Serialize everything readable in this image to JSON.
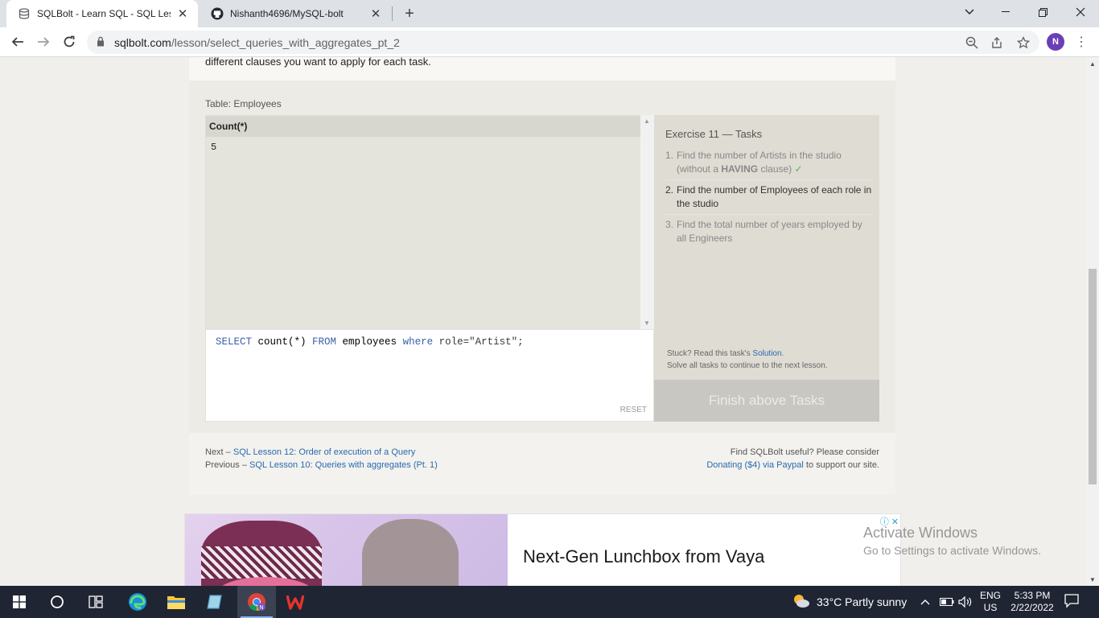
{
  "browser": {
    "tabs": [
      {
        "title": "SQLBolt - Learn SQL - SQL Lesso",
        "active": true
      },
      {
        "title": "Nishanth4696/MySQL-bolt",
        "active": false
      }
    ],
    "url_host": "sqlbolt.com",
    "url_path": "/lesson/select_queries_with_aggregates_pt_2",
    "profile_initial": "N"
  },
  "page": {
    "intro_text": "different clauses you want to apply for each task.",
    "table_caption": "Table: Employees",
    "results": {
      "column": "Count(*)",
      "value": "5"
    },
    "query": {
      "part1": "SELECT",
      "part2": " count(*) ",
      "part3": "FROM",
      "part4": " employees ",
      "part5": "where",
      "part6": " role=\"Artist\";"
    },
    "reset_label": "RESET",
    "tasks": {
      "title": "Exercise 11 — Tasks",
      "items": [
        {
          "num": "1.",
          "text_a": "Find the number of Artists in the studio (without a ",
          "bold": "HAVING",
          "text_b": " clause)",
          "check": "✓"
        },
        {
          "num": "2.",
          "text": "Find the number of Employees of each role in the studio"
        },
        {
          "num": "3.",
          "text": "Find the total number of years employed by all Engineers"
        }
      ],
      "stuck_prefix": "Stuck? Read this task's ",
      "solution_link": "Solution",
      "stuck_suffix": ".",
      "solve_all": "Solve all tasks to continue to the next lesson.",
      "finish_label": "Finish above Tasks"
    },
    "footer": {
      "next_prefix": "Next – ",
      "next_link": "SQL Lesson 12: Order of execution of a Query",
      "prev_prefix": "Previous – ",
      "prev_link": "SQL Lesson 10: Queries with aggregates (Pt. 1)",
      "useful": "Find SQLBolt useful? Please consider",
      "donate_link": "Donating ($4) via Paypal",
      "donate_suffix": " to support our site."
    },
    "ad": {
      "headline": "Next-Gen Lunchbox from Vaya",
      "choices": "ⓘ ✕"
    },
    "watermark": {
      "line1": "Activate Windows",
      "line2": "Go to Settings to activate Windows."
    }
  },
  "taskbar": {
    "weather": "33°C  Partly sunny",
    "lang_top": "ENG",
    "lang_bottom": "US",
    "time": "5:33 PM",
    "date": "2/22/2022"
  },
  "colors": {
    "accent_link": "#2a6ab0",
    "check": "#6cae4f",
    "taskbar": "#1f2533"
  }
}
